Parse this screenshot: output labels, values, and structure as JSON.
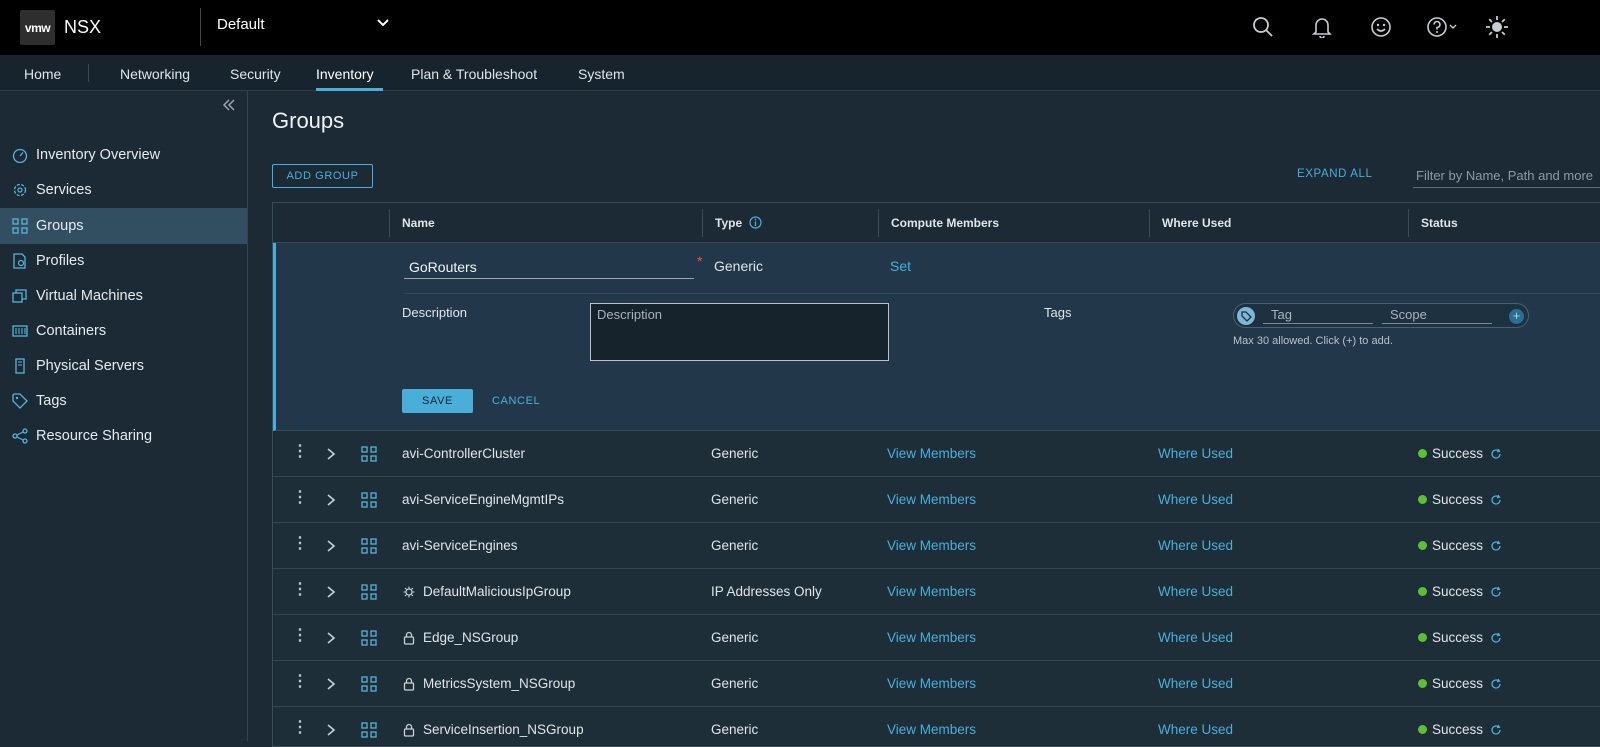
{
  "header": {
    "logo_text": "vmw",
    "brand": "NSX",
    "project": "Default"
  },
  "nav": {
    "tabs": [
      "Home",
      "Networking",
      "Security",
      "Inventory",
      "Plan & Troubleshoot",
      "System"
    ],
    "active": "Inventory"
  },
  "sidebar": {
    "items": [
      {
        "label": "Inventory Overview",
        "icon": "dashboard-icon"
      },
      {
        "label": "Services",
        "icon": "services-gear-icon"
      },
      {
        "label": "Groups",
        "icon": "groups-icon"
      },
      {
        "label": "Profiles",
        "icon": "profiles-icon"
      },
      {
        "label": "Virtual Machines",
        "icon": "vm-icon"
      },
      {
        "label": "Containers",
        "icon": "containers-icon"
      },
      {
        "label": "Physical Servers",
        "icon": "server-icon"
      },
      {
        "label": "Tags",
        "icon": "tag-icon"
      },
      {
        "label": "Resource Sharing",
        "icon": "share-icon"
      }
    ],
    "active": "Groups"
  },
  "page": {
    "title": "Groups",
    "add_group": "ADD GROUP",
    "expand_all": "EXPAND ALL",
    "filter_placeholder": "Filter by Name, Path and more"
  },
  "grid": {
    "columns": [
      "Name",
      "Type",
      "Compute Members",
      "Where Used",
      "Status"
    ]
  },
  "edit": {
    "name_value": "GoRouters",
    "required_mark": "*",
    "type": "Generic",
    "compute_link": "Set",
    "description_label": "Description",
    "description_placeholder": "Description",
    "tags_label": "Tags",
    "tag_placeholder": "Tag",
    "scope_placeholder": "Scope",
    "tag_hint": "Max 30 allowed. Click (+) to add.",
    "save": "SAVE",
    "cancel": "CANCEL"
  },
  "rows": [
    {
      "name": "avi-ControllerCluster",
      "type": "Generic",
      "members": "View Members",
      "where_used": "Where Used",
      "status": "Success",
      "sub_icon": ""
    },
    {
      "name": "avi-ServiceEngineMgmtIPs",
      "type": "Generic",
      "members": "View Members",
      "where_used": "Where Used",
      "status": "Success",
      "sub_icon": ""
    },
    {
      "name": "avi-ServiceEngines",
      "type": "Generic",
      "members": "View Members",
      "where_used": "Where Used",
      "status": "Success",
      "sub_icon": ""
    },
    {
      "name": "DefaultMaliciousIpGroup",
      "type": "IP Addresses Only",
      "members": "View Members",
      "where_used": "Where Used",
      "status": "Success",
      "sub_icon": "virus-icon"
    },
    {
      "name": "Edge_NSGroup",
      "type": "Generic",
      "members": "View Members",
      "where_used": "Where Used",
      "status": "Success",
      "sub_icon": "lock-icon"
    },
    {
      "name": "MetricsSystem_NSGroup",
      "type": "Generic",
      "members": "View Members",
      "where_used": "Where Used",
      "status": "Success",
      "sub_icon": "lock-icon"
    },
    {
      "name": "ServiceInsertion_NSGroup",
      "type": "Generic",
      "members": "View Members",
      "where_used": "Where Used",
      "status": "Success",
      "sub_icon": "lock-icon"
    }
  ],
  "colors": {
    "accent": "#49afd9",
    "success": "#5ebf35",
    "required": "#e05a47"
  }
}
